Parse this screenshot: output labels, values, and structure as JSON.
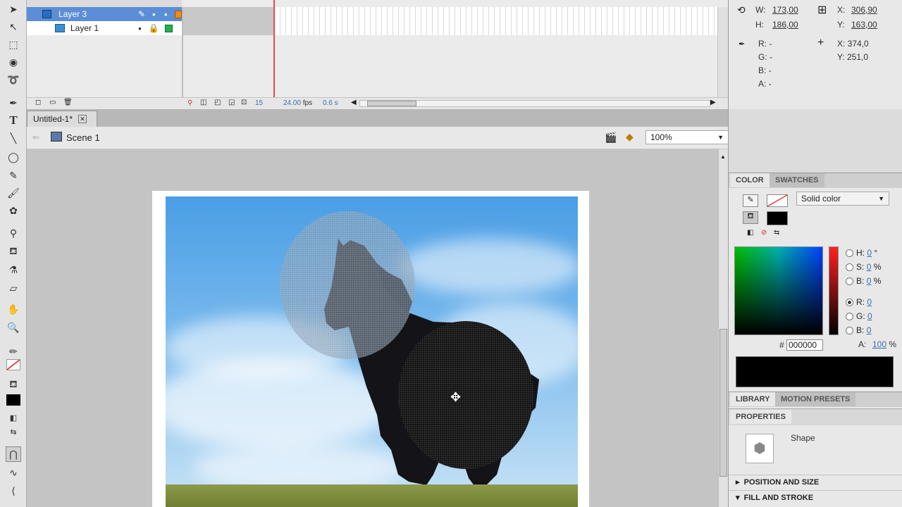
{
  "timeline": {
    "layers": [
      {
        "name": "Layer 3",
        "selected": true,
        "color": "#f08a1c"
      },
      {
        "name": "Layer 1",
        "selected": false,
        "color": "#22b14c"
      }
    ],
    "frame_num": "15",
    "fps": "24.00",
    "fps_unit": "fps",
    "time": "0.6 s"
  },
  "document": {
    "tab_title": "Untitled-1*",
    "scene": "Scene 1",
    "zoom": "100%"
  },
  "info": {
    "w_label": "W:",
    "w_value": "173,00",
    "h_label": "H:",
    "h_value": "186,00",
    "x_label": "X:",
    "x_value": "306,90",
    "y_label": "Y:",
    "y_value": "163,00",
    "r_label": "R: -",
    "g_label": "G: -",
    "b_label": "B: -",
    "a_label": "A: -",
    "cx_label": "X: 374,0",
    "cy_label": "Y: 251,0"
  },
  "color_panel": {
    "tab_color": "COLOR",
    "tab_swatches": "SWATCHES",
    "type": "Solid color",
    "h_label": "H:",
    "h_value": "0",
    "h_unit": "°",
    "s_label": "S:",
    "s_value": "0",
    "s_unit": "%",
    "b_label": "B:",
    "b_value": "0",
    "b_unit": "%",
    "r_label": "R:",
    "r_value": "0",
    "g_label": "G:",
    "g_value": "0",
    "bb_label": "B:",
    "bb_value": "0",
    "hash": "#",
    "hex": "000000",
    "alpha_label": "A:",
    "alpha": "100",
    "alpha_unit": "%",
    "fill_color": "#000000"
  },
  "library": {
    "tab_library": "LIBRARY",
    "tab_motion": "MOTION PRESETS"
  },
  "properties": {
    "title": "PROPERTIES",
    "object_type": "Shape",
    "section_pos": "POSITION AND SIZE",
    "section_fill": "FILL AND STROKE"
  }
}
